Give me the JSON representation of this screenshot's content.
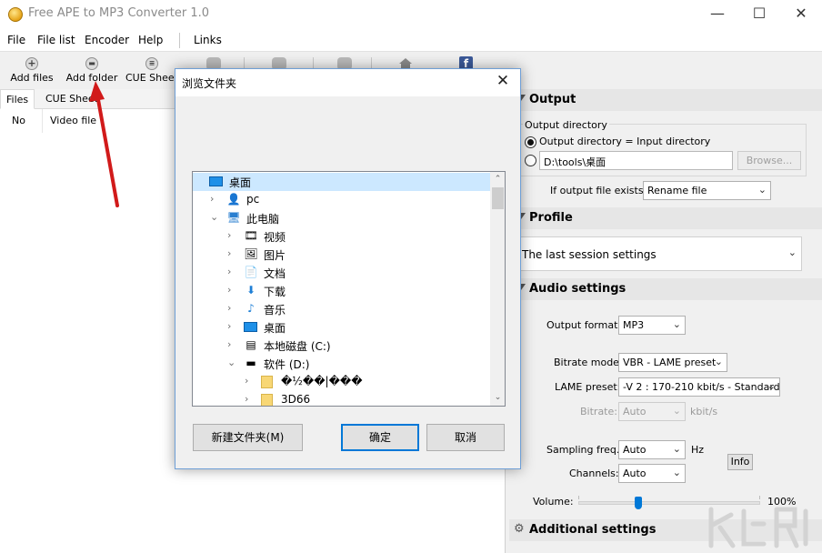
{
  "window": {
    "title": "Free APE to MP3 Converter 1.0",
    "minimize": "—",
    "maximize": "☐",
    "close": "✕"
  },
  "menu": [
    "File",
    "File list",
    "Encoder",
    "Help",
    "Links"
  ],
  "toolbar": {
    "add_files": "Add files",
    "add_folder": "Add folder",
    "cue_sheet": "CUE Sheet"
  },
  "tabs": [
    "Files",
    "CUE Sheet"
  ],
  "file_columns": [
    "No",
    "Video file"
  ],
  "output": {
    "header": "Output",
    "group_label": "Output directory",
    "radio_same": "Output directory = Input directory",
    "path": "D:\\tools\\桌面",
    "browse": "Browse...",
    "exists_label": "If output file exists:",
    "exists_value": "Rename file"
  },
  "profile": {
    "header": "Profile",
    "value": "The last session settings"
  },
  "audio": {
    "header": "Audio settings",
    "format_label": "Output format:",
    "format_value": "MP3",
    "bitrate_mode_label": "Bitrate mode:",
    "bitrate_mode_value": "VBR - LAME preset",
    "lame_label": "LAME preset:",
    "lame_value": "-V 2 : 170-210 kbit/s - Standard",
    "bitrate_label": "Bitrate:",
    "bitrate_value": "Auto",
    "bitrate_unit": "kbit/s",
    "sampling_label": "Sampling freq.:",
    "sampling_value": "Auto",
    "sampling_unit": "Hz",
    "info": "Info",
    "channels_label": "Channels:",
    "channels_value": "Auto",
    "volume_label": "Volume:",
    "volume_value": "100%",
    "volume_level": 0.33
  },
  "additional": {
    "header": "Additional settings"
  },
  "dialog": {
    "title": "浏览文件夹",
    "close": "✕",
    "tree": [
      {
        "label": "桌面",
        "icon": "desktop-icon",
        "glyph": "▭",
        "level": 0,
        "twisty": "",
        "selected": true
      },
      {
        "label": "pc",
        "icon": "user-icon",
        "glyph": "👤",
        "level": 1,
        "twisty": "›"
      },
      {
        "label": "此电脑",
        "icon": "computer-icon",
        "glyph": "🖥",
        "level": 1,
        "twisty": "⌄"
      },
      {
        "label": "视频",
        "icon": "video-folder-icon",
        "glyph": "🎞",
        "level": 2,
        "twisty": "›"
      },
      {
        "label": "图片",
        "icon": "pictures-folder-icon",
        "glyph": "🖼",
        "level": 2,
        "twisty": "›"
      },
      {
        "label": "文档",
        "icon": "documents-folder-icon",
        "glyph": "📄",
        "level": 2,
        "twisty": "›"
      },
      {
        "label": "下载",
        "icon": "downloads-folder-icon",
        "glyph": "⬇",
        "level": 2,
        "twisty": "›"
      },
      {
        "label": "音乐",
        "icon": "music-folder-icon",
        "glyph": "♪",
        "level": 2,
        "twisty": "›"
      },
      {
        "label": "桌面",
        "icon": "desktop-folder-icon",
        "glyph": "▭",
        "level": 2,
        "twisty": "›"
      },
      {
        "label": "本地磁盘 (C:)",
        "icon": "drive-c-icon",
        "glyph": "▤",
        "level": 2,
        "twisty": "›"
      },
      {
        "label": "软件 (D:)",
        "icon": "drive-d-icon",
        "glyph": "▬",
        "level": 2,
        "twisty": "⌄"
      },
      {
        "label": "�½��|���",
        "icon": "folder-icon",
        "glyph": "",
        "level": 3,
        "twisty": "›"
      },
      {
        "label": "3D66",
        "icon": "folder-icon",
        "glyph": "",
        "level": 3,
        "twisty": "›"
      }
    ],
    "new_folder": "新建文件夹(M)",
    "ok": "确定",
    "cancel": "取消"
  },
  "colors": {
    "accent": "#0078d7",
    "annotation_arrow": "#d11a1a"
  }
}
